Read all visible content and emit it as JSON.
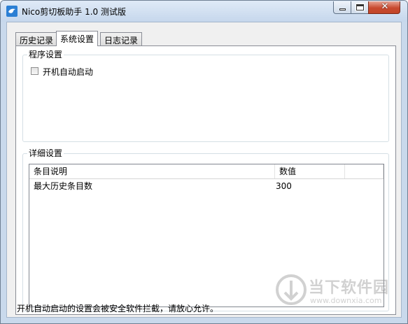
{
  "window": {
    "title": "Nico剪切板助手 1.0 测试版",
    "close_glyph": "✕"
  },
  "tabs": [
    {
      "label": "历史记录",
      "active": false
    },
    {
      "label": "系统设置",
      "active": true
    },
    {
      "label": "日志记录",
      "active": false
    }
  ],
  "program_settings": {
    "group_label": "程序设置",
    "autostart_label": "开机自动启动",
    "autostart_checked": false
  },
  "detail_settings": {
    "group_label": "详细设置",
    "columns": [
      "条目说明",
      "数值"
    ],
    "rows": [
      {
        "name": "最大历史条目数",
        "value": "300"
      }
    ]
  },
  "status": {
    "message": "开机自动启动的设置会被安全软件拦截，请放心允许。"
  },
  "watermark": {
    "name": "当下软件园",
    "url": "www.downxia.com"
  },
  "colors": {
    "titlebar": "#c9d9ec",
    "close_button": "#c8492f",
    "app_icon": "#2b7fd4"
  }
}
